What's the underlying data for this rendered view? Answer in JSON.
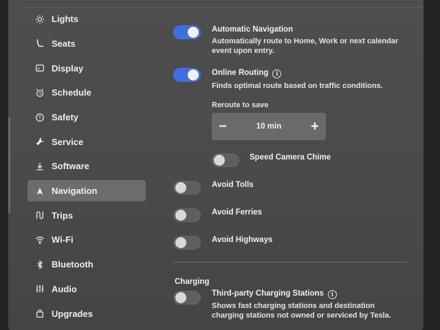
{
  "sidebar": {
    "items": [
      {
        "label": "Lights",
        "icon": "sun-icon"
      },
      {
        "label": "Seats",
        "icon": "seat-icon"
      },
      {
        "label": "Display",
        "icon": "display-icon"
      },
      {
        "label": "Schedule",
        "icon": "alarm-clock-icon"
      },
      {
        "label": "Safety",
        "icon": "alert-circle-icon"
      },
      {
        "label": "Service",
        "icon": "wrench-icon"
      },
      {
        "label": "Software",
        "icon": "download-icon"
      },
      {
        "label": "Navigation",
        "icon": "navigation-arrow-icon",
        "active": true
      },
      {
        "label": "Trips",
        "icon": "trips-icon"
      },
      {
        "label": "Wi-Fi",
        "icon": "wifi-icon"
      },
      {
        "label": "Bluetooth",
        "icon": "bluetooth-icon"
      },
      {
        "label": "Audio",
        "icon": "equalizer-icon"
      },
      {
        "label": "Upgrades",
        "icon": "shopping-bag-icon"
      }
    ]
  },
  "navigation": {
    "automatic_navigation": {
      "label": "Automatic Navigation",
      "desc_line1": "Automatically route to Home, Work or next calendar",
      "desc_line2": "event upon entry.",
      "on": true
    },
    "online_routing": {
      "label": "Online Routing",
      "desc": "Finds optimal route based on traffic conditions.",
      "on": true
    },
    "reroute": {
      "label": "Reroute to save",
      "value": "10 min",
      "minus": "−",
      "plus": "+"
    },
    "speed_camera_chime": {
      "label": "Speed Camera Chime",
      "on": false
    },
    "avoid_tolls": {
      "label": "Avoid Tolls",
      "on": false
    },
    "avoid_ferries": {
      "label": "Avoid Ferries",
      "on": false
    },
    "avoid_highways": {
      "label": "Avoid Highways",
      "on": false
    }
  },
  "charging": {
    "section_title": "Charging",
    "third_party": {
      "label": "Third-party Charging Stations",
      "desc_line1": "Shows fast charging stations and destination",
      "desc_line2": "charging stations not owned or serviced by Tesla.",
      "on": false
    }
  },
  "colors": {
    "accent": "#3f6ee0",
    "background": "#4c4c4e",
    "active_item": "#6c6c6e"
  }
}
